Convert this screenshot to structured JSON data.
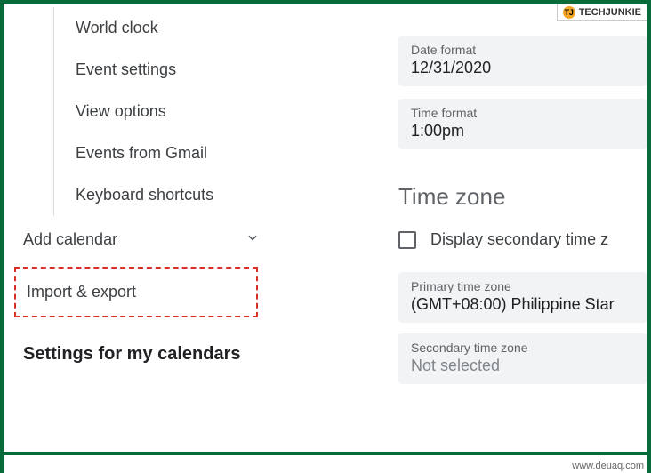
{
  "watermark": {
    "badge": "TECHJUNKIE",
    "badge_initials": "TJ",
    "url": "www.deuaq.com"
  },
  "sidebar": {
    "group_items": [
      {
        "label": "World clock"
      },
      {
        "label": "Event settings"
      },
      {
        "label": "View options"
      },
      {
        "label": "Events from Gmail"
      },
      {
        "label": "Keyboard shortcuts"
      }
    ],
    "add_calendar": "Add calendar",
    "import_export": "Import & export",
    "settings_heading": "Settings for my calendars"
  },
  "content": {
    "date_format": {
      "label": "Date format",
      "value": "12/31/2020"
    },
    "time_format": {
      "label": "Time format",
      "value": "1:00pm"
    },
    "timezone_heading": "Time zone",
    "secondary_checkbox_label": "Display secondary time z",
    "primary_tz": {
      "label": "Primary time zone",
      "value": "(GMT+08:00) Philippine Star"
    },
    "secondary_tz": {
      "label": "Secondary time zone",
      "value": "Not selected"
    }
  }
}
